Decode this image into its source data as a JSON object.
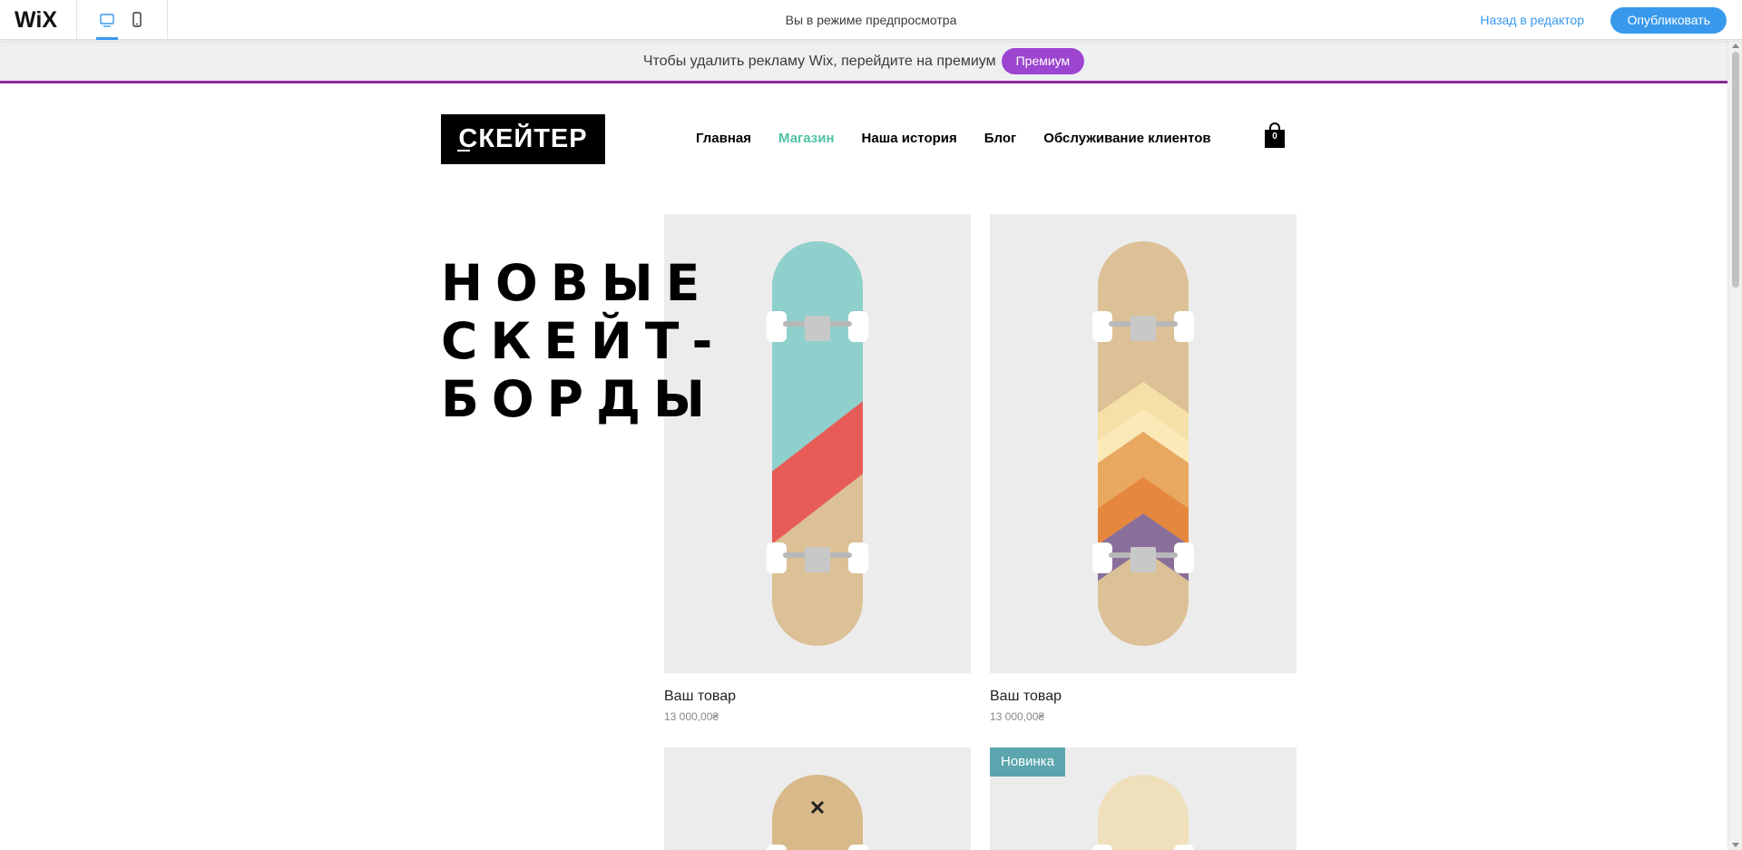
{
  "editor": {
    "logo": "WiX",
    "preview_text": "Вы в режиме предпросмотра",
    "back_label": "Назад в редактор",
    "publish_label": "Опубликовать"
  },
  "ad": {
    "text": "Чтобы удалить рекламу Wix, перейдите на премиум",
    "button": "Премиум"
  },
  "site": {
    "logo": "СКЕЙТЕР",
    "nav": [
      "Главная",
      "Магазин",
      "Наша история",
      "Блог",
      "Обслуживание клиентов"
    ],
    "active_nav": "Магазин",
    "cart_count": "0",
    "hero_lines": [
      "НОВЫЕ",
      "СКЕЙТ-",
      "БОРДЫ"
    ],
    "products": [
      {
        "title": "Ваш товар",
        "price": "13 000,00₴"
      },
      {
        "title": "Ваш товар",
        "price": "13 000,00₴"
      },
      {
        "title": "",
        "price": ""
      },
      {
        "title": "",
        "price": "",
        "ribbon": "Новинка"
      }
    ]
  },
  "colors": {
    "accent_blue": "#3899ec",
    "premium_purple": "#9c45d0",
    "nav_active": "#4fc2a3",
    "ribbon": "#5aa5ae"
  }
}
